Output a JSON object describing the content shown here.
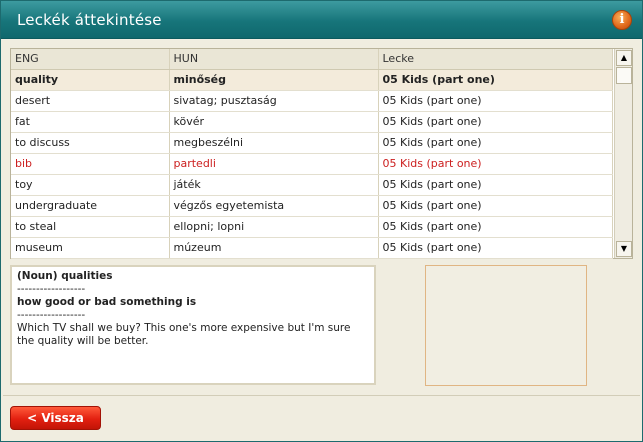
{
  "window": {
    "title": "Leckék áttekintése",
    "info_icon": "i"
  },
  "table": {
    "headers": {
      "eng": "ENG",
      "hun": "HUN",
      "lecke": "Lecke"
    },
    "rows": [
      {
        "eng": "quality",
        "hun": "minőség",
        "lecke": "05 Kids (part one)"
      },
      {
        "eng": "desert",
        "hun": "sivatag; pusztaság",
        "lecke": "05 Kids (part one)"
      },
      {
        "eng": "fat",
        "hun": "kövér",
        "lecke": "05 Kids (part one)"
      },
      {
        "eng": "to discuss",
        "hun": "megbeszélni",
        "lecke": "05 Kids (part one)"
      },
      {
        "eng": "bib",
        "hun": "partedli",
        "lecke": "05 Kids (part one)"
      },
      {
        "eng": "toy",
        "hun": "játék",
        "lecke": "05 Kids (part one)"
      },
      {
        "eng": "undergraduate",
        "hun": "végzős egyetemista",
        "lecke": "05 Kids (part one)"
      },
      {
        "eng": "to steal",
        "hun": "ellopni; lopni",
        "lecke": "05 Kids (part one)"
      },
      {
        "eng": "museum",
        "hun": "múzeum",
        "lecke": "05 Kids (part one)"
      }
    ],
    "highlight_color": "#cc1f1f"
  },
  "definition": {
    "line1": "(Noun) qualities",
    "sep1": "------------------",
    "line2": "how good or bad something is",
    "sep2": "------------------",
    "example": "Which TV shall we buy? This one's more expensive but I'm sure the quality will be better."
  },
  "buttons": {
    "back": "< Vissza"
  },
  "scrollbar": {
    "up_arrow": "▲",
    "down_arrow": "▼"
  },
  "colors": {
    "titlebar": "#17757a",
    "accent": "#e22010"
  }
}
